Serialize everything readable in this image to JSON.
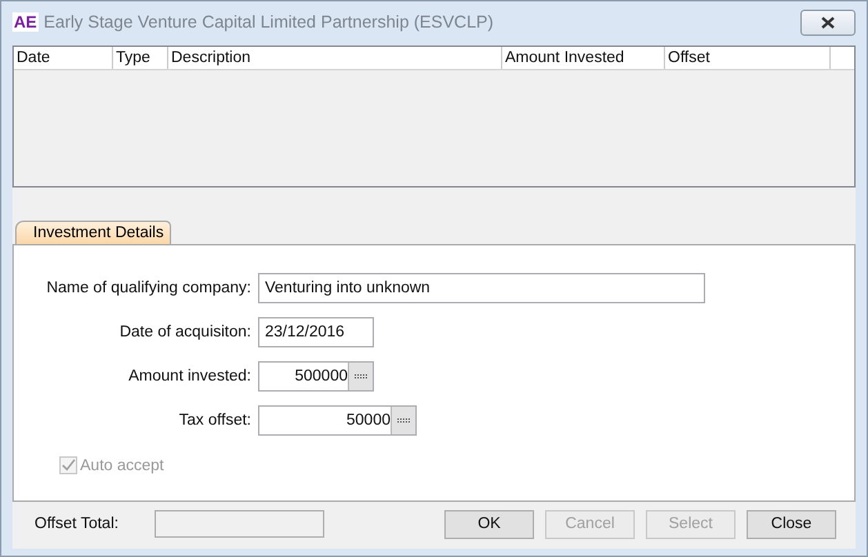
{
  "window": {
    "title": "Early Stage Venture Capital Limited Partnership (ESVCLP)",
    "app_badge": "AE"
  },
  "table": {
    "columns": [
      "Date",
      "Type",
      "Description",
      "Amount Invested",
      "Offset"
    ]
  },
  "tabs": [
    {
      "label": "Investment Details",
      "selected": true
    }
  ],
  "form": {
    "fields": [
      {
        "label": "Name of qualifying company:",
        "value": "Venturing into unknown",
        "kind": "text"
      },
      {
        "label": "Date of acquisiton:",
        "value": "23/12/2016",
        "kind": "date"
      },
      {
        "label": "Amount invested:",
        "value": "500000",
        "kind": "calc"
      },
      {
        "label": "Tax offset:",
        "value": "50000",
        "kind": "calc"
      }
    ],
    "auto_accept": {
      "label": "Auto accept",
      "checked": true,
      "disabled": true
    }
  },
  "footer": {
    "total_label": "Offset Total:",
    "buttons": [
      {
        "label": "OK",
        "disabled": false
      },
      {
        "label": "Cancel",
        "disabled": true
      },
      {
        "label": "Select",
        "disabled": true
      },
      {
        "label": "Close",
        "disabled": false
      }
    ]
  }
}
